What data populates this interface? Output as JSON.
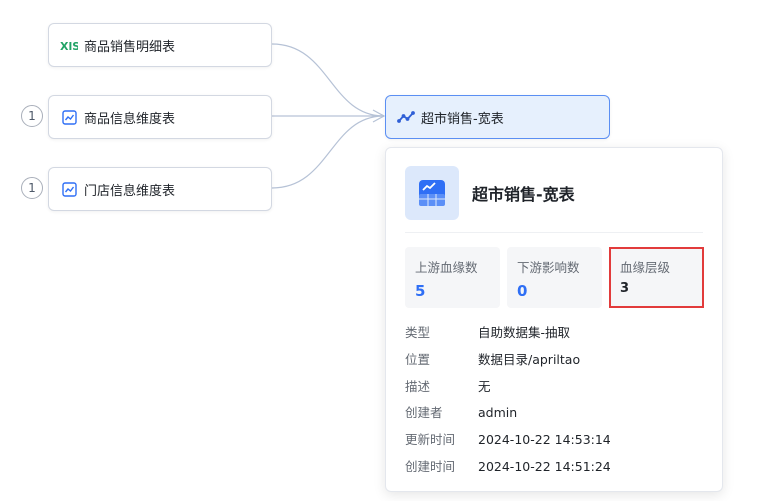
{
  "nodes": {
    "source1": {
      "label": "商品销售明细表",
      "icon": "xls-file-icon"
    },
    "source2": {
      "label": "商品信息维度表",
      "icon": "chart-table-icon",
      "badge": "1"
    },
    "source3": {
      "label": "门店信息维度表",
      "icon": "chart-table-icon",
      "badge": "1"
    },
    "target": {
      "label": "超市销售-宽表",
      "icon": "dataset-lineage-icon"
    }
  },
  "details": {
    "title": "超市销售-宽表",
    "stats": [
      {
        "label": "上游血缘数",
        "value": "5"
      },
      {
        "label": "下游影响数",
        "value": "0"
      },
      {
        "label": "血缘层级",
        "value": "3"
      }
    ],
    "fields": [
      {
        "key": "类型",
        "value": "自助数据集-抽取"
      },
      {
        "key": "位置",
        "value": "数据目录/apriltao"
      },
      {
        "key": "描述",
        "value": "无"
      },
      {
        "key": "创建者",
        "value": "admin"
      },
      {
        "key": "更新时间",
        "value": "2024-10-22 14:53:14"
      },
      {
        "key": "创建时间",
        "value": "2024-10-22 14:51:24"
      }
    ]
  },
  "colors": {
    "accent": "#2f6ff5",
    "highlight_border": "#e23b3b",
    "target_node_bg": "#e6f0fd",
    "edge": "#b6c2d6",
    "xls_green": "#21a366"
  }
}
